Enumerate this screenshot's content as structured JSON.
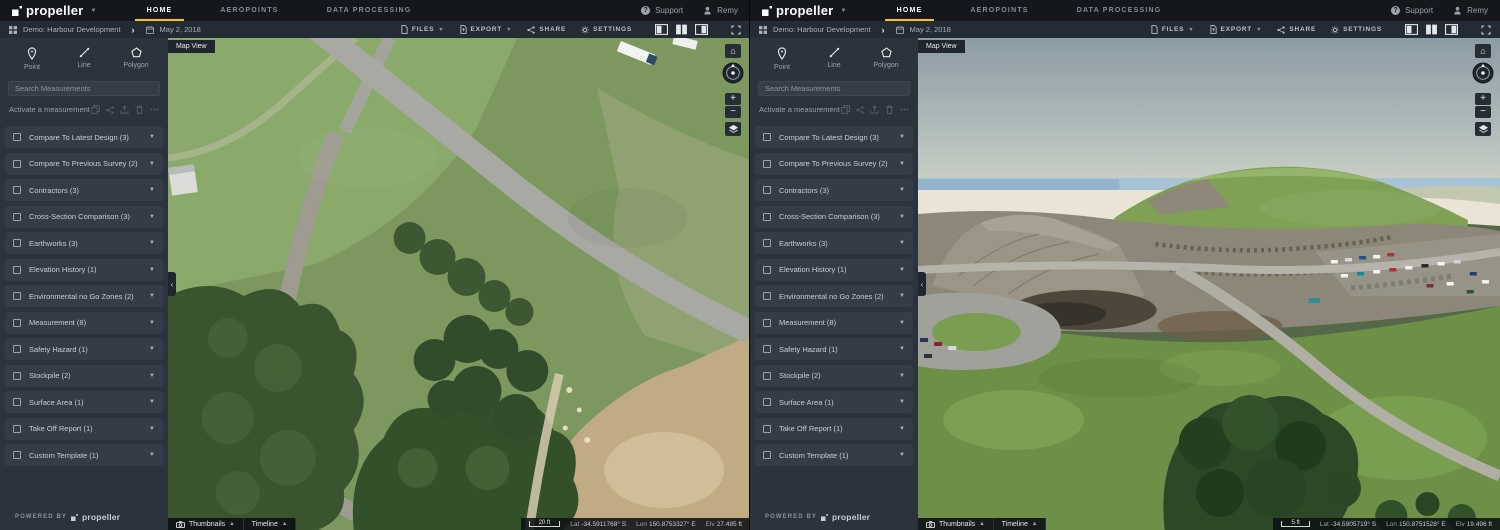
{
  "colors": {
    "accent": "#ffc400",
    "topnav_bg": "#14171b",
    "panel_bg": "#2b333c",
    "card_bg": "#343d47"
  },
  "brand": {
    "name": "propeller",
    "powered_by": "POWERED BY"
  },
  "nav": {
    "items": [
      {
        "label": "HOME"
      },
      {
        "label": "AEROPOINTS"
      },
      {
        "label": "DATA PROCESSING"
      }
    ],
    "support": "Support",
    "user": "Remy"
  },
  "breadcrumb": {
    "site": "Demo: Harbour Development",
    "date": "May 2, 2018"
  },
  "toolbar": {
    "files": "FILES",
    "export": "EXPORT",
    "share": "SHARE",
    "settings": "SETTINGS"
  },
  "tools": {
    "point": "Point",
    "line": "Line",
    "polygon": "Polygon"
  },
  "search": {
    "placeholder": "Search Measurements"
  },
  "activate": {
    "label": "Activate a measurement"
  },
  "categories": [
    {
      "label": "Compare To Latest Design (3)"
    },
    {
      "label": "Compare To Previous Survey (2)"
    },
    {
      "label": "Contractors (3)"
    },
    {
      "label": "Cross-Section Comparison (3)"
    },
    {
      "label": "Earthworks (3)"
    },
    {
      "label": "Elevation History (1)"
    },
    {
      "label": "Environmental no Go Zones (2)"
    },
    {
      "label": "Measurement (8)"
    },
    {
      "label": "Safety Hazard (1)"
    },
    {
      "label": "Stockpile (2)"
    },
    {
      "label": "Surface Area (1)"
    },
    {
      "label": "Take Off Report (1)"
    },
    {
      "label": "Custom Template (1)"
    }
  ],
  "map": {
    "view_label": "Map View",
    "thumbnails": "Thumbnails",
    "timeline": "Timeline"
  },
  "status_labels": {
    "lat": "Lat",
    "lon": "Lon",
    "elv": "Elv"
  },
  "left_pane": {
    "status": {
      "scale": "20 ft",
      "lat": "-34.5911768° S",
      "lon": "150.8753327° E",
      "elv": "27.495 ft"
    }
  },
  "right_pane": {
    "status": {
      "scale": "5 ft",
      "lat": "-34.5905719° S",
      "lon": "150.8751528° E",
      "elv": "19.496 ft"
    }
  }
}
